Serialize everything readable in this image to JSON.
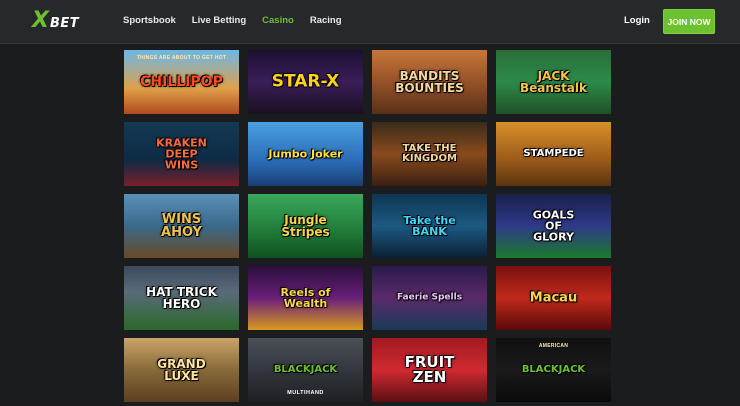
{
  "brand": {
    "logo_x": "X",
    "logo_bet": "BET"
  },
  "nav": {
    "items": [
      {
        "label": "Sportsbook",
        "active": false
      },
      {
        "label": "Live Betting",
        "active": false
      },
      {
        "label": "Casino",
        "active": true
      },
      {
        "label": "Racing",
        "active": false
      }
    ]
  },
  "header": {
    "login_label": "Login",
    "join_label": "JOIN NOW"
  },
  "colors": {
    "accent": "#6cc12e",
    "bg": "#1b1c1e",
    "topbar": "#26282b"
  },
  "games": [
    {
      "title": "CHILLIPOP",
      "tag": "THINGS ARE ABOUT TO GET HOT",
      "bg": "linear-gradient(180deg,#6bb8e8 0%,#e0a048 60%,#b04a20 100%)",
      "color": "#ff4b1f",
      "size": 14
    },
    {
      "title": "STAR-X",
      "bg": "linear-gradient(180deg,#1b1030 0%,#3a1e5a 50%,#181020 100%)",
      "color": "#ffd21f",
      "size": 17
    },
    {
      "title": "BANDITS\nBOUNTIES",
      "bg": "linear-gradient(180deg,#c7763a 0%,#8a4b24 60%,#5a2f18 100%)",
      "color": "#f5d8a0",
      "size": 12
    },
    {
      "title": "JACK\nBeanstalk",
      "bg": "linear-gradient(180deg,#2a6e3a 0%,#2c8a48 50%,#1e5226 100%)",
      "color": "#f0c64a",
      "size": 12
    },
    {
      "title": "KRAKEN\nDEEP\nWINS",
      "bg": "linear-gradient(180deg,#133a55 0%,#0f2a44 60%,#7a1f2a 100%)",
      "color": "#ff6a3c",
      "size": 11
    },
    {
      "title": "Jumbo Joker",
      "bg": "linear-gradient(180deg,#4a9fe0 0%,#2b6db8 60%,#183f75 100%)",
      "color": "#ffe23a",
      "size": 11
    },
    {
      "title": "TAKE THE\nKINGDOM",
      "bg": "linear-gradient(180deg,#3a2a1a 0%,#8a4a1c 50%,#3a2010 100%)",
      "color": "#f3d7a2",
      "size": 10
    },
    {
      "title": "STAMPEDE",
      "bg": "linear-gradient(180deg,#d8902a 0%,#9a5a18 60%,#5a3410 100%)",
      "color": "#ffffff",
      "size": 10
    },
    {
      "title": "WINS\nAHOY",
      "bg": "linear-gradient(180deg,#5a90b8 0%,#3a6a8a 50%,#6a4a28 100%)",
      "color": "#f2c24a",
      "size": 13
    },
    {
      "title": "Jungle\nStripes",
      "bg": "linear-gradient(180deg,#3aa85a 0%,#1f7a38 60%,#10501f 100%)",
      "color": "#f5d74a",
      "size": 12
    },
    {
      "title": "Take the\nBANK",
      "bg": "linear-gradient(180deg,#0f3552 0%,#1b5a82 50%,#0a2034 100%)",
      "color": "#3fd6ff",
      "size": 11
    },
    {
      "title": "GOALS\nOF\nGLORY",
      "bg": "linear-gradient(180deg,#1a1f4a 0%,#2e3a8a 50%,#1b7a2a 100%)",
      "color": "#ffffff",
      "size": 11
    },
    {
      "title": "HAT TRICK\nHERO",
      "bg": "linear-gradient(180deg,#3a4a5a 0%,#5a6a7a 40%,#2a6a2a 100%)",
      "color": "#ffffff",
      "size": 12
    },
    {
      "title": "Reels of\nWealth",
      "bg": "linear-gradient(180deg,#2a0f3a 0%,#6a1f7a 50%,#d89a20 100%)",
      "color": "#ffd84a",
      "size": 11
    },
    {
      "title": "Faerie Spells",
      "bg": "linear-gradient(180deg,#2a1a4a 0%,#5a2a6a 50%,#1a3a5a 100%)",
      "color": "#f0c6ff",
      "size": 9
    },
    {
      "title": "Macau",
      "bg": "linear-gradient(180deg,#7a1010 0%,#c02a1a 50%,#5a0a0a 100%)",
      "color": "#ffd34a",
      "size": 13
    },
    {
      "title": "GRAND\nLUXE",
      "bg": "linear-gradient(180deg,#c9a46a 0%,#8a6a3a 50%,#5a4020 100%)",
      "color": "#ffe6a0",
      "size": 12
    },
    {
      "title": "BLACKJACK",
      "sub": "MULTIHAND",
      "bg": "linear-gradient(180deg,#4a5058 0%,#2e3238 60%,#1e2024 100%)",
      "color": "#6cc12e",
      "size": 10
    },
    {
      "title": "FRUIT\nZEN",
      "bg": "linear-gradient(180deg,#a01a20 0%,#d02a30 50%,#5a0f14 100%)",
      "color": "#ffffff",
      "size": 15
    },
    {
      "title": "BLACKJACK",
      "tag": "AMERICAN",
      "bg": "linear-gradient(180deg,#101010 0%,#1a1a1a 50%,#0a0a0a 100%)",
      "color": "#6cc12e",
      "size": 10
    }
  ]
}
